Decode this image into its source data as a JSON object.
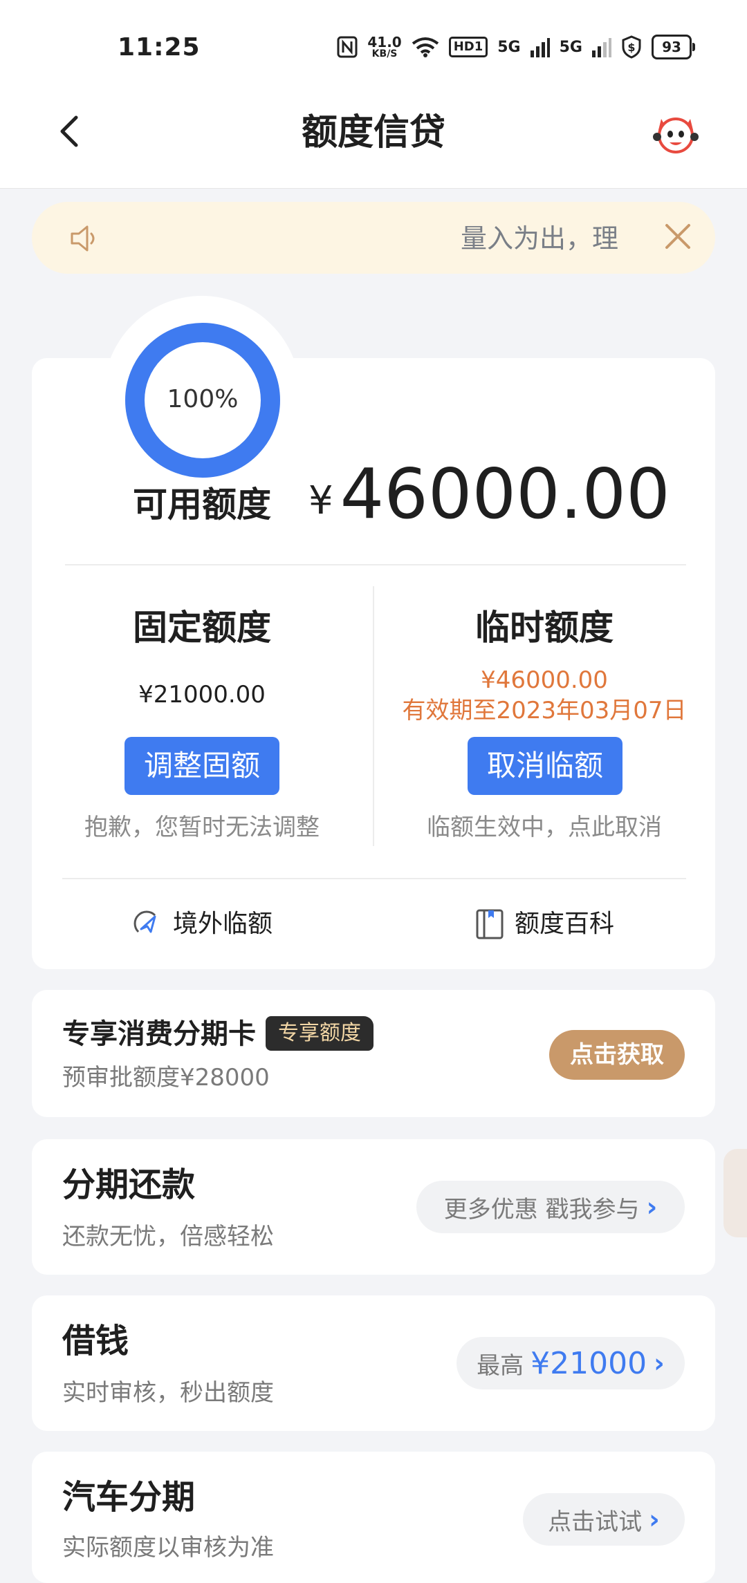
{
  "status_bar": {
    "time": "11:25",
    "speed_value": "41.0",
    "speed_unit": "KB/S",
    "hd_label": "HD1",
    "signal1": "5G",
    "signal2": "5G",
    "battery": "93",
    "icons": [
      "nfc-icon",
      "wifi-icon",
      "signal-icon",
      "shield-dollar-icon",
      "battery-icon"
    ]
  },
  "header": {
    "title": "额度信贷"
  },
  "notice": {
    "text": "量入为出，理"
  },
  "quota": {
    "ring_percent_text": "100%",
    "ring_progress": 1.0,
    "available_label": "可用额度",
    "available_currency": "¥",
    "available_amount": "46000.00",
    "fixed": {
      "title": "固定额度",
      "amount": "¥21000.00",
      "button": "调整固额",
      "note": "抱歉，您暂时无法调整"
    },
    "temporary": {
      "title": "临时额度",
      "amount": "¥46000.00",
      "validity": "有效期至2023年03月07日",
      "button": "取消临额",
      "note": "临额生效中，点此取消"
    },
    "links": {
      "overseas": "境外临额",
      "encyclopedia": "额度百科"
    }
  },
  "exclusive": {
    "title": "专享消费分期卡",
    "tag": "专享额度",
    "subtitle": "预审批额度¥28000",
    "button": "点击获取"
  },
  "items": [
    {
      "title": "分期还款",
      "subtitle": "还款无忧，倍感轻松",
      "action_prefix": "更多优惠 戳我参与",
      "action_highlight": ""
    },
    {
      "title": "借钱",
      "subtitle": "实时审核，秒出额度",
      "action_prefix": "最高",
      "action_highlight": "¥21000"
    },
    {
      "title": "汽车分期",
      "subtitle": "实际额度以审核为准",
      "action_prefix": "点击试试",
      "action_highlight": ""
    }
  ],
  "colors": {
    "accent_blue": "#3f7bf0",
    "orange": "#e0773b",
    "gold_button": "#c9996a",
    "notice_bg": "#fdf5e3"
  }
}
